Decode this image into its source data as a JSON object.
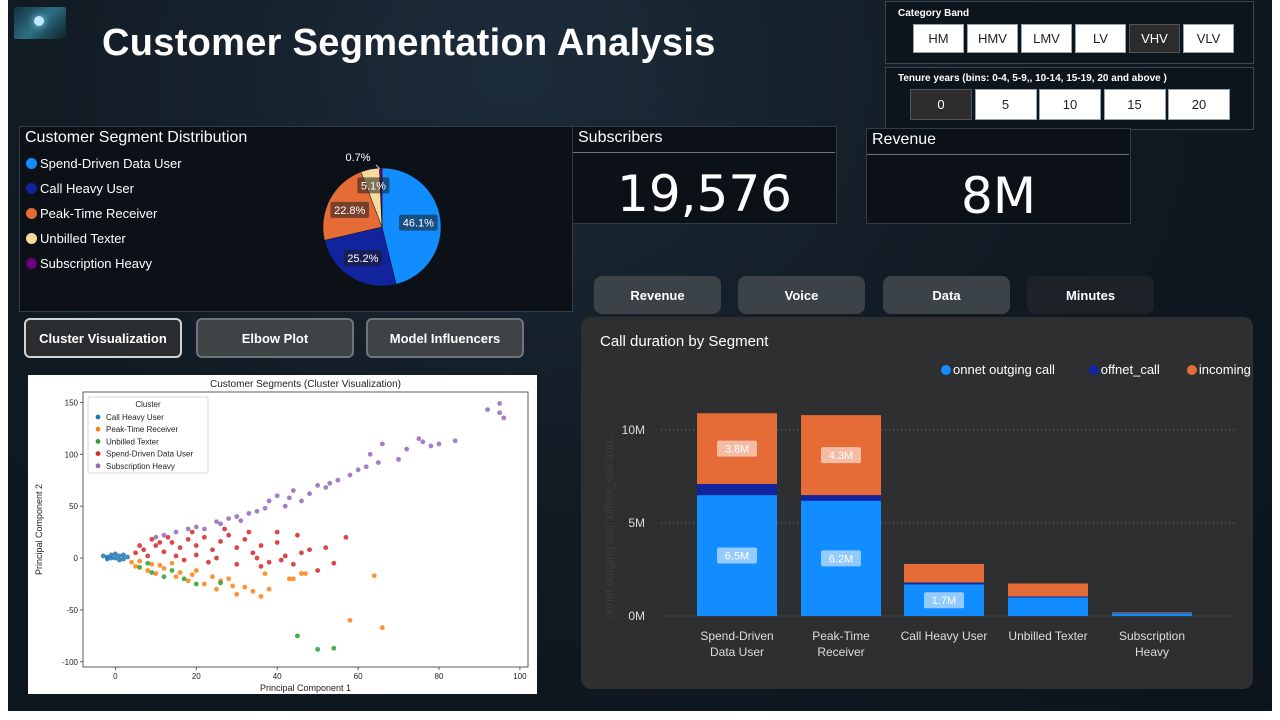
{
  "header": {
    "title": "Customer Segmentation Analysis"
  },
  "category_band": {
    "title": "Category Band",
    "options": [
      "HM",
      "HMV",
      "LMV",
      "LV",
      "VHV",
      "VLV"
    ],
    "selected": "VHV"
  },
  "tenure": {
    "title": "Tenure years (bins: 0-4, 5-9,, 10-14, 15-19, 20 and above )",
    "options": [
      "0",
      "5",
      "10",
      "15",
      "20"
    ],
    "selected": "0"
  },
  "segment_distribution": {
    "title": "Customer Segment Distribution",
    "legend": [
      {
        "label": "Spend-Driven Data User",
        "color": "#118dff"
      },
      {
        "label": "Call Heavy User",
        "color": "#12239e"
      },
      {
        "label": "Peak-Time Receiver",
        "color": "#e66c37"
      },
      {
        "label": "Unbilled Texter",
        "color": "#f5dc9c"
      },
      {
        "label": "Subscription Heavy",
        "color": "#6b007b"
      }
    ]
  },
  "kpis": {
    "subscribers_title": "Subscribers",
    "subscribers_value": "19,576",
    "revenue_title": "Revenue",
    "revenue_value": "8M"
  },
  "metric_tabs": [
    {
      "label": "Revenue",
      "active": false
    },
    {
      "label": "Voice",
      "active": false
    },
    {
      "label": "Data",
      "active": false
    },
    {
      "label": "Minutes",
      "active": true
    }
  ],
  "view_buttons": [
    {
      "label": "Cluster Visualization",
      "active": true
    },
    {
      "label": "Elbow Plot",
      "active": false
    },
    {
      "label": "Model Influencers",
      "active": false
    }
  ],
  "chart_data": [
    {
      "type": "pie",
      "title": "",
      "slices": [
        {
          "name": "Spend-Driven Data User",
          "value": 46.1,
          "label": "46.1%",
          "color": "#118dff"
        },
        {
          "name": "Call Heavy User",
          "value": 25.2,
          "label": "25.2%",
          "color": "#12239e"
        },
        {
          "name": "Peak-Time Receiver",
          "value": 22.8,
          "label": "22.8%",
          "color": "#e66c37"
        },
        {
          "name": "Unbilled Texter",
          "value": 5.1,
          "label": "5.1%",
          "color": "#f5dc9c"
        },
        {
          "name": "Subscription Heavy",
          "value": 0.7,
          "label": "0.7%",
          "color": "#6b007b"
        }
      ]
    },
    {
      "type": "bar",
      "stacked": true,
      "title": "Call duration by Segment",
      "ylabel": "onnet outging call, offnet_call and...",
      "ylim": [
        0,
        12000000
      ],
      "yticks": [
        0,
        5000000,
        10000000
      ],
      "yticklabels": [
        "0M",
        "5M",
        "10M"
      ],
      "legend_position": "top-right",
      "categories": [
        "Spend-Driven Data User",
        "Peak-Time Receiver",
        "Call Heavy User",
        "Unbilled Texter",
        "Subscription Heavy"
      ],
      "category_labels": [
        [
          "Spend-Driven",
          "Data User"
        ],
        [
          "Peak-Time",
          "Receiver"
        ],
        [
          "Call Heavy User"
        ],
        [
          "Unbilled Texter"
        ],
        [
          "Subscription",
          "Heavy"
        ]
      ],
      "series": [
        {
          "name": "onnet outging call",
          "color": "#118dff",
          "values": [
            6500000,
            6200000,
            1700000,
            1000000,
            150000
          ],
          "labels": [
            "6.5M",
            "6.2M",
            "1.7M",
            "",
            ""
          ]
        },
        {
          "name": "offnet_call",
          "color": "#12239e",
          "values": [
            600000,
            300000,
            100000,
            50000,
            20000
          ],
          "labels": [
            "",
            "",
            "",
            "",
            ""
          ]
        },
        {
          "name": "incoming call",
          "color": "#e66c37",
          "values": [
            3800000,
            4300000,
            1000000,
            700000,
            30000
          ],
          "labels": [
            "3.8M",
            "4.3M",
            "",
            "",
            ""
          ]
        }
      ]
    },
    {
      "type": "scatter",
      "title": "Customer Segments (Cluster Visualization)",
      "xlabel": "Principal Component 1",
      "ylabel": "Principal Component 2",
      "xlim": [
        -8,
        102
      ],
      "ylim": [
        -105,
        160
      ],
      "xticks": [
        0,
        20,
        40,
        60,
        80,
        100
      ],
      "yticks": [
        -100,
        -50,
        0,
        50,
        100,
        150
      ],
      "legend_title": "Cluster",
      "series": [
        {
          "name": "Call Heavy User",
          "color": "#1f77b4",
          "points": [
            [
              -3,
              2
            ],
            [
              -2,
              1
            ],
            [
              -1,
              3
            ],
            [
              0,
              0
            ],
            [
              1,
              2
            ],
            [
              2,
              -1
            ],
            [
              -2,
              -1
            ],
            [
              0,
              4
            ],
            [
              1,
              -2
            ],
            [
              3,
              1
            ],
            [
              -1,
              0
            ],
            [
              2,
              3
            ]
          ]
        },
        {
          "name": "Peak-Time Receiver",
          "color": "#ff7f0e",
          "points": [
            [
              5,
              -8
            ],
            [
              8,
              -12
            ],
            [
              10,
              -15
            ],
            [
              12,
              -10
            ],
            [
              15,
              -18
            ],
            [
              18,
              -22
            ],
            [
              20,
              -12
            ],
            [
              22,
              -25
            ],
            [
              25,
              -30
            ],
            [
              28,
              -20
            ],
            [
              30,
              -35
            ],
            [
              32,
              -28
            ],
            [
              34,
              -32
            ],
            [
              36,
              -37
            ],
            [
              38,
              -30
            ],
            [
              14,
              -5
            ],
            [
              6,
              -3
            ],
            [
              16,
              -14
            ],
            [
              24,
              -18
            ],
            [
              44,
              -20
            ],
            [
              47,
              -15
            ],
            [
              37,
              -15
            ],
            [
              46,
              -15
            ],
            [
              43,
              -20
            ],
            [
              58,
              -60
            ],
            [
              66,
              -67
            ],
            [
              64,
              -17
            ],
            [
              4,
              -4
            ],
            [
              9,
              -6
            ],
            [
              11,
              -7
            ],
            [
              19,
              -16
            ],
            [
              26,
              -22
            ],
            [
              29,
              -27
            ]
          ]
        },
        {
          "name": "Unbilled Texter",
          "color": "#2ca02c",
          "points": [
            [
              6,
              -9
            ],
            [
              9,
              -14
            ],
            [
              12,
              -18
            ],
            [
              17,
              -20
            ],
            [
              20,
              -25
            ],
            [
              26,
              -24
            ],
            [
              45,
              -75
            ],
            [
              50,
              -88
            ],
            [
              54,
              -87
            ],
            [
              8,
              -5
            ],
            [
              14,
              -12
            ]
          ]
        },
        {
          "name": "Spend-Driven Data User",
          "color": "#d62728",
          "points": [
            [
              5,
              5
            ],
            [
              7,
              8
            ],
            [
              10,
              12
            ],
            [
              12,
              6
            ],
            [
              14,
              15
            ],
            [
              16,
              10
            ],
            [
              18,
              18
            ],
            [
              20,
              12
            ],
            [
              22,
              20
            ],
            [
              24,
              8
            ],
            [
              26,
              16
            ],
            [
              28,
              22
            ],
            [
              30,
              10
            ],
            [
              32,
              18
            ],
            [
              34,
              5
            ],
            [
              36,
              12
            ],
            [
              38,
              -4
            ],
            [
              40,
              15
            ],
            [
              42,
              2
            ],
            [
              44,
              -6
            ],
            [
              46,
              5
            ],
            [
              48,
              8
            ],
            [
              50,
              -12
            ],
            [
              52,
              10
            ],
            [
              54,
              -5
            ],
            [
              57,
              20
            ],
            [
              40,
              25
            ],
            [
              45,
              22
            ],
            [
              36,
              -8
            ],
            [
              30,
              -6
            ],
            [
              25,
              0
            ],
            [
              15,
              2
            ],
            [
              8,
              2
            ],
            [
              20,
              3
            ],
            [
              11,
              15
            ],
            [
              13,
              20
            ],
            [
              19,
              25
            ],
            [
              27,
              28
            ],
            [
              33,
              25
            ],
            [
              6,
              12
            ],
            [
              9,
              18
            ],
            [
              17,
              -2
            ],
            [
              23,
              -4
            ],
            [
              35,
              0
            ],
            [
              41,
              -2
            ]
          ]
        },
        {
          "name": "Subscription Heavy",
          "color": "#9467bd",
          "points": [
            [
              10,
              20
            ],
            [
              15,
              25
            ],
            [
              20,
              30
            ],
            [
              25,
              35
            ],
            [
              30,
              40
            ],
            [
              35,
              45
            ],
            [
              38,
              55
            ],
            [
              40,
              60
            ],
            [
              42,
              50
            ],
            [
              44,
              65
            ],
            [
              46,
              55
            ],
            [
              48,
              62
            ],
            [
              50,
              70
            ],
            [
              52,
              68
            ],
            [
              55,
              75
            ],
            [
              58,
              80
            ],
            [
              60,
              85
            ],
            [
              62,
              88
            ],
            [
              63,
              100
            ],
            [
              65,
              92
            ],
            [
              66,
              110
            ],
            [
              70,
              95
            ],
            [
              72,
              105
            ],
            [
              75,
              115
            ],
            [
              76,
              112
            ],
            [
              78,
              108
            ],
            [
              80,
              110
            ],
            [
              84,
              113
            ],
            [
              92,
              143
            ],
            [
              95,
              140
            ],
            [
              96,
              135
            ],
            [
              95,
              149
            ],
            [
              22,
              28
            ],
            [
              28,
              38
            ],
            [
              33,
              43
            ],
            [
              37,
              48
            ],
            [
              12,
              22
            ],
            [
              18,
              28
            ],
            [
              26,
              33
            ],
            [
              31,
              36
            ],
            [
              43,
              58
            ],
            [
              53,
              72
            ]
          ]
        }
      ]
    }
  ]
}
